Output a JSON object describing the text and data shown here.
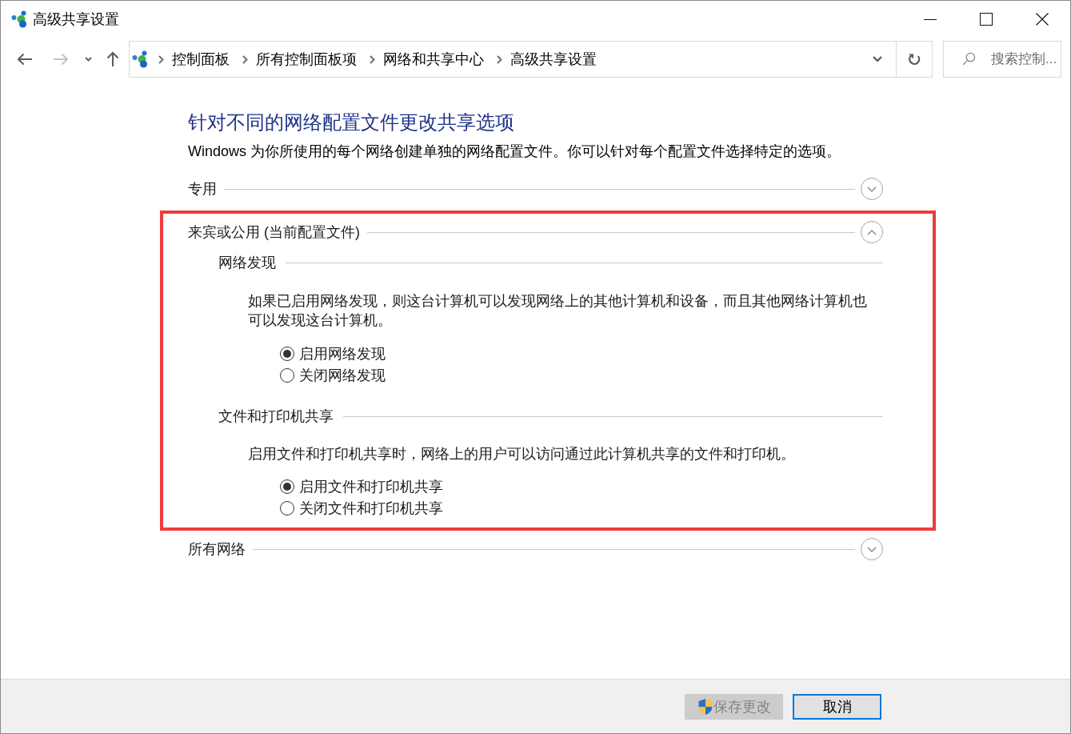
{
  "window": {
    "title": "高级共享设置"
  },
  "nav_buttons": [
    {
      "kind": "back",
      "disabled": false
    },
    {
      "kind": "forward",
      "disabled": true
    },
    {
      "kind": "recent",
      "disabled": false
    },
    {
      "kind": "up",
      "disabled": false
    }
  ],
  "address_bar": {
    "breadcrumbs": [
      "控制面板",
      "所有控制面板项",
      "网络和共享中心",
      "高级共享设置"
    ]
  },
  "search": {
    "placeholder": "搜索控制..."
  },
  "heading": "针对不同的网络配置文件更改共享选项",
  "description": "Windows 为你所使用的每个网络创建单独的网络配置文件。你可以针对每个配置文件选择特定的选项。",
  "sections": [
    {
      "title": "专用",
      "expanded": false,
      "highlighted": false
    },
    {
      "title": "来宾或公用 (当前配置文件)",
      "expanded": true,
      "highlighted": true,
      "groups": [
        {
          "title": "网络发现",
          "description": "如果已启用网络发现，则这台计算机可以发现网络上的其他计算机和设备，而且其他网络计算机也可以发现这台计算机。",
          "options": [
            {
              "label": "启用网络发现",
              "selected": true
            },
            {
              "label": "关闭网络发现",
              "selected": false
            }
          ]
        },
        {
          "title": "文件和打印机共享",
          "description": "启用文件和打印机共享时，网络上的用户可以访问通过此计算机共享的文件和打印机。",
          "options": [
            {
              "label": "启用文件和打印机共享",
              "selected": true
            },
            {
              "label": "关闭文件和打印机共享",
              "selected": false
            }
          ]
        }
      ]
    },
    {
      "title": "所有网络",
      "expanded": false,
      "highlighted": false
    }
  ],
  "buttons": [
    {
      "kind": "save",
      "label": "保存更改",
      "disabled": true,
      "default": false
    },
    {
      "kind": "cancel",
      "label": "取消",
      "disabled": false,
      "default": true
    }
  ]
}
